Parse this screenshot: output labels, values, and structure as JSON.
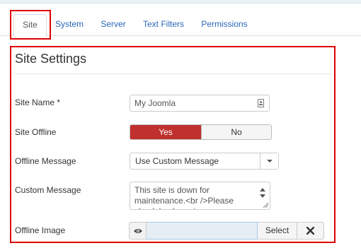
{
  "tabs": [
    {
      "label": "Site",
      "active": true
    },
    {
      "label": "System",
      "active": false
    },
    {
      "label": "Server",
      "active": false
    },
    {
      "label": "Text Filters",
      "active": false
    },
    {
      "label": "Permissions",
      "active": false
    }
  ],
  "fieldset": {
    "legend": "Site Settings"
  },
  "fields": {
    "site_name": {
      "label": "Site Name *",
      "value": "My Joomla",
      "icon": "contact-card-icon"
    },
    "site_offline": {
      "label": "Site Offline",
      "yes_label": "Yes",
      "no_label": "No",
      "selected": "Yes"
    },
    "offline_message": {
      "label": "Offline Message",
      "selected": "Use Custom Message"
    },
    "custom_message": {
      "label": "Custom Message",
      "value": "This site is down for maintenance.<br />Please check back again soon."
    },
    "offline_image": {
      "label": "Offline Image",
      "select_label": "Select",
      "value": ""
    }
  },
  "colors": {
    "yes_active": "#c0302e",
    "tab_link": "#2a69b8",
    "highlight": "#e00000"
  }
}
